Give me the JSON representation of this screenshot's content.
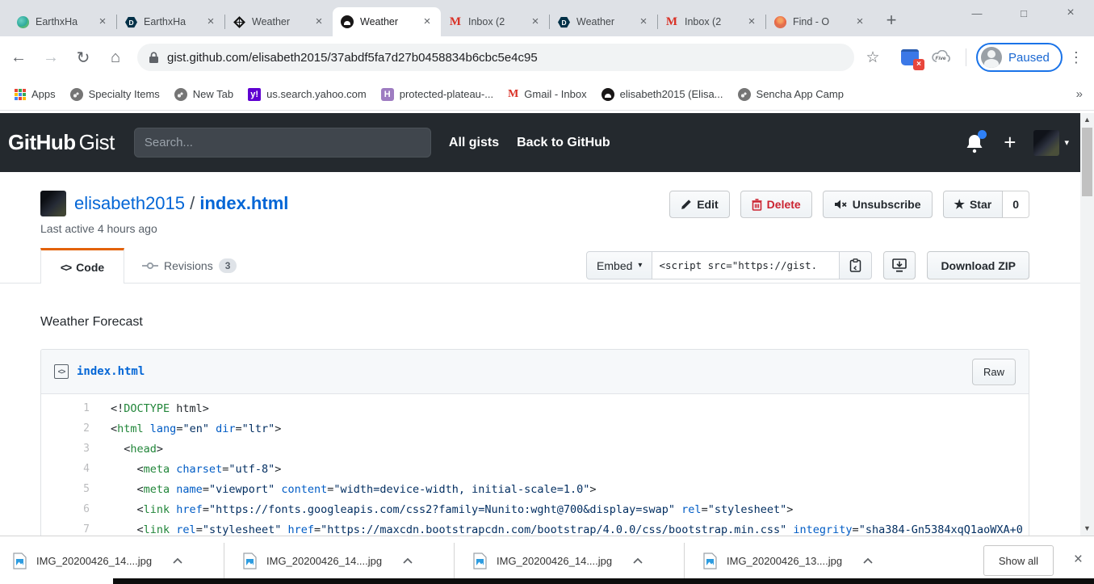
{
  "icons": {
    "back": "←",
    "forward": "→",
    "reload": "↻",
    "home": "⌂",
    "star_outline": "☆",
    "star_filled": "★",
    "menu_dots": "⋮",
    "overflow_chevron": "»",
    "caret_down": "▾",
    "close": "×",
    "minimize": "—",
    "maximize": "□",
    "plus": "+",
    "up_arrow": "▲",
    "down_arrow": "▼",
    "code_brackets": "<>",
    "gmail_m": "M",
    "yahoo": "y!",
    "heroku": "H",
    "fiverr": "Five"
  },
  "browser": {
    "tabs": [
      {
        "title": "EarthxHa",
        "icon": "globe-teal-icon"
      },
      {
        "title": "EarthxHa",
        "icon": "devpost-icon"
      },
      {
        "title": "Weather",
        "icon": "diamond-icon"
      },
      {
        "title": "Weather",
        "icon": "github-icon",
        "active": true
      },
      {
        "title": "Inbox (2",
        "icon": "gmail-icon"
      },
      {
        "title": "Weather",
        "icon": "devpost-icon"
      },
      {
        "title": "Inbox (2",
        "icon": "gmail-icon"
      },
      {
        "title": "Find - O",
        "icon": "sunset-icon"
      }
    ],
    "url": "gist.github.com/elisabeth2015/37abdf5fa7d27b0458834b6cbc5e4c95",
    "profile_label": "Paused",
    "bookmarks": [
      {
        "label": "Apps",
        "icon": "apps-grid-icon"
      },
      {
        "label": "Specialty Items",
        "icon": "globe-icon"
      },
      {
        "label": "New Tab",
        "icon": "globe-icon"
      },
      {
        "label": "us.search.yahoo.com",
        "icon": "yahoo-icon"
      },
      {
        "label": "protected-plateau-...",
        "icon": "heroku-icon"
      },
      {
        "label": "Gmail - Inbox",
        "icon": "gmail-icon"
      },
      {
        "label": "elisabeth2015 (Elisa...",
        "icon": "github-icon"
      },
      {
        "label": "Sencha App Camp",
        "icon": "globe-icon"
      }
    ]
  },
  "gist_header": {
    "logo_bold": "GitHub",
    "logo_light": "Gist",
    "search_placeholder": "Search...",
    "nav": [
      "All gists",
      "Back to GitHub"
    ]
  },
  "gist": {
    "owner": "elisabeth2015",
    "separator": " / ",
    "filename": "index.html",
    "last_active": "Last active 4 hours ago",
    "buttons": {
      "edit": "Edit",
      "delete": "Delete",
      "unsubscribe": "Unsubscribe",
      "star": "Star",
      "star_count": "0"
    },
    "tabs": {
      "code": "Code",
      "revisions": "Revisions",
      "revisions_count": "3"
    },
    "embed": {
      "label": "Embed",
      "snippet": "<script src=\"https://gist.",
      "download_zip": "Download ZIP"
    },
    "description": "Weather Forecast",
    "file": {
      "name": "index.html",
      "raw": "Raw"
    }
  },
  "code": {
    "lines": [
      {
        "n": 1,
        "tk": [
          [
            "p",
            "<!"
          ],
          [
            "k",
            "DOCTYPE"
          ],
          [
            "p",
            " html>"
          ]
        ]
      },
      {
        "n": 2,
        "tk": [
          [
            "p",
            "<"
          ],
          [
            "k",
            "html"
          ],
          [
            "p",
            " "
          ],
          [
            "a",
            "lang"
          ],
          [
            "p",
            "="
          ],
          [
            "s",
            "\"en\""
          ],
          [
            "p",
            " "
          ],
          [
            "a",
            "dir"
          ],
          [
            "p",
            "="
          ],
          [
            "s",
            "\"ltr\""
          ],
          [
            "p",
            ">"
          ]
        ]
      },
      {
        "n": 3,
        "tk": [
          [
            "p",
            "  <"
          ],
          [
            "k",
            "head"
          ],
          [
            "p",
            ">"
          ]
        ]
      },
      {
        "n": 4,
        "tk": [
          [
            "p",
            "    <"
          ],
          [
            "k",
            "meta"
          ],
          [
            "p",
            " "
          ],
          [
            "a",
            "charset"
          ],
          [
            "p",
            "="
          ],
          [
            "s",
            "\"utf-8\""
          ],
          [
            "p",
            ">"
          ]
        ]
      },
      {
        "n": 5,
        "tk": [
          [
            "p",
            "    <"
          ],
          [
            "k",
            "meta"
          ],
          [
            "p",
            " "
          ],
          [
            "a",
            "name"
          ],
          [
            "p",
            "="
          ],
          [
            "s",
            "\"viewport\""
          ],
          [
            "p",
            " "
          ],
          [
            "a",
            "content"
          ],
          [
            "p",
            "="
          ],
          [
            "s",
            "\"width=device-width, initial-scale=1.0\""
          ],
          [
            "p",
            ">"
          ]
        ]
      },
      {
        "n": 6,
        "tk": [
          [
            "p",
            "    <"
          ],
          [
            "k",
            "link"
          ],
          [
            "p",
            " "
          ],
          [
            "a",
            "href"
          ],
          [
            "p",
            "="
          ],
          [
            "s",
            "\"https://fonts.googleapis.com/css2?family=Nunito:wght@700&display=swap\""
          ],
          [
            "p",
            " "
          ],
          [
            "a",
            "rel"
          ],
          [
            "p",
            "="
          ],
          [
            "s",
            "\"stylesheet\""
          ],
          [
            "p",
            ">"
          ]
        ]
      },
      {
        "n": 7,
        "tk": [
          [
            "p",
            "    <"
          ],
          [
            "k",
            "link"
          ],
          [
            "p",
            " "
          ],
          [
            "a",
            "rel"
          ],
          [
            "p",
            "="
          ],
          [
            "s",
            "\"stylesheet\""
          ],
          [
            "p",
            " "
          ],
          [
            "a",
            "href"
          ],
          [
            "p",
            "="
          ],
          [
            "s",
            "\"https://maxcdn.bootstrapcdn.com/bootstrap/4.0.0/css/bootstrap.min.css\""
          ],
          [
            "p",
            " "
          ],
          [
            "a",
            "integrity"
          ],
          [
            "p",
            "="
          ],
          [
            "s",
            "\"sha384-Gn5384xqQ1aoWXA+0"
          ]
        ]
      }
    ]
  },
  "downloads": {
    "items": [
      {
        "name": "IMG_20200426_14....jpg"
      },
      {
        "name": "IMG_20200426_14....jpg"
      },
      {
        "name": "IMG_20200426_14....jpg"
      },
      {
        "name": "IMG_20200426_13....jpg"
      }
    ],
    "show_all": "Show all"
  }
}
